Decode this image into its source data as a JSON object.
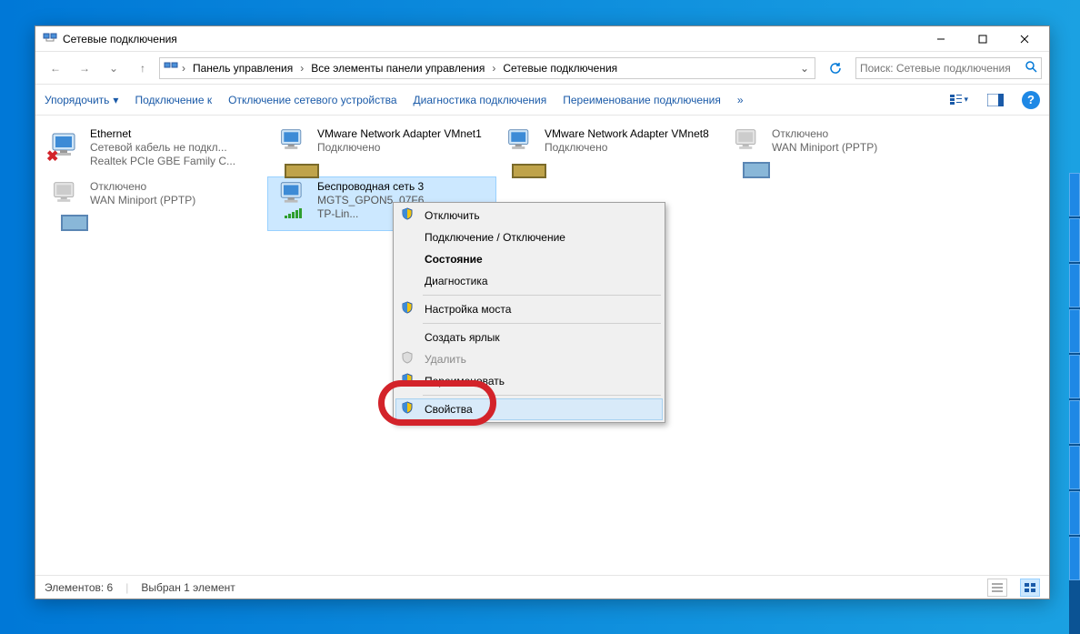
{
  "window": {
    "title": "Сетевые подключения"
  },
  "breadcrumb": {
    "root": "Панель управления",
    "mid": "Все элементы панели управления",
    "leaf": "Сетевые подключения"
  },
  "search": {
    "placeholder": "Поиск: Сетевые подключения"
  },
  "toolbar": {
    "organize": "Упорядочить",
    "connect": "Подключение к",
    "disable": "Отключение сетевого устройства",
    "diagnose": "Диагностика подключения",
    "rename": "Переименование подключения",
    "more": "»"
  },
  "items": [
    {
      "name": "Ethernet",
      "line2": "Сетевой кабель не подкл...",
      "line3": "Realtek PCIe GBE Family C...",
      "state": "disconnected"
    },
    {
      "name": "VMware Network Adapter VMnet1",
      "line2": "Подключено",
      "line3": "",
      "state": "connected"
    },
    {
      "name": "VMware Network Adapter VMnet8",
      "line2": "Подключено",
      "line3": "",
      "state": "connected"
    },
    {
      "name": "",
      "line2": "Отключено",
      "line3": "WAN Miniport (PPTP)",
      "state": "disabled"
    },
    {
      "name": "",
      "line2": "Отключено",
      "line3": "WAN Miniport (PPTP)",
      "state": "disabled"
    },
    {
      "name": "Беспроводная сеть 3",
      "line2": "MGTS_GPON5_07F6",
      "line3": "TP-Lin...",
      "state": "wifi"
    }
  ],
  "context_menu": {
    "disable": "Отключить",
    "toggle": "Подключение / Отключение",
    "status": "Состояние",
    "diagnose": "Диагностика",
    "bridge": "Настройка моста",
    "shortcut": "Создать ярлык",
    "delete": "Удалить",
    "rename": "Переименовать",
    "properties": "Свойства"
  },
  "status": {
    "count_label": "Элементов: 6",
    "selection_label": "Выбран 1 элемент"
  }
}
